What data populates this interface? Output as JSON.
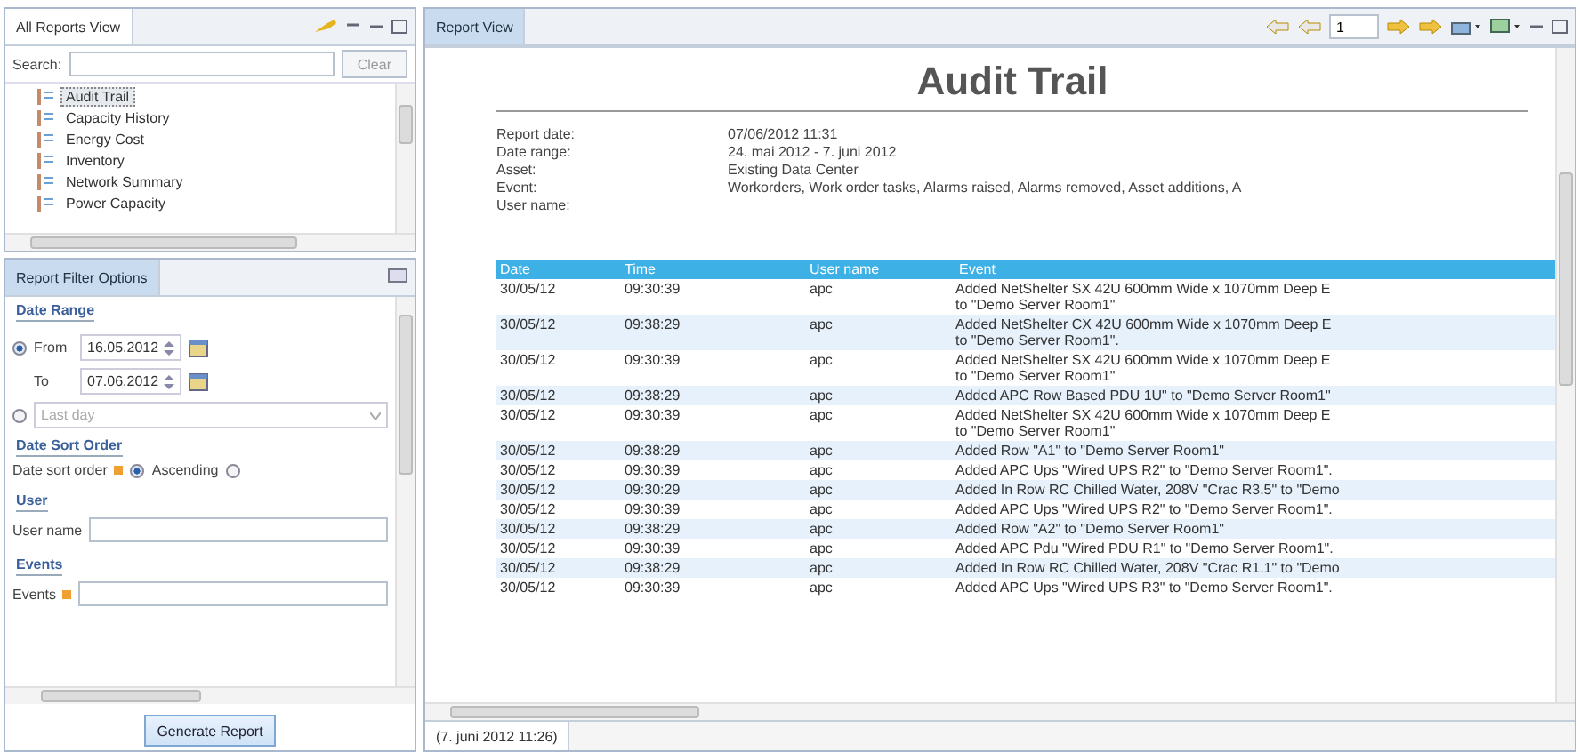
{
  "left_view": {
    "tab": "All Reports View",
    "search": {
      "label": "Search:"
    },
    "clear_button": "Clear",
    "reports": [
      {
        "label": "Audit Trail",
        "selected": true
      },
      {
        "label": "Capacity History",
        "selected": false
      },
      {
        "label": "Energy Cost",
        "selected": false
      },
      {
        "label": "Inventory",
        "selected": false
      },
      {
        "label": "Network Summary",
        "selected": false
      },
      {
        "label": "Power Capacity",
        "selected": false
      }
    ]
  },
  "filter": {
    "title": "Report Filter Options",
    "date_range": {
      "heading": "Date Range",
      "from_label": "From",
      "from": "16.05.2012",
      "to_label": "To",
      "to": "07.06.2012",
      "range_selected": true,
      "last_selected": false,
      "last_option": "Last day"
    },
    "sort": {
      "heading": "Date Sort Order",
      "label": "Date sort order",
      "option": "Ascending",
      "ascending": true,
      "other_selected": false
    },
    "user": {
      "heading": "User",
      "label": "User name"
    },
    "events": {
      "heading": "Events",
      "label": "Events"
    },
    "generate_button": "Generate Report"
  },
  "report_view": {
    "tab": "Report View",
    "page": "1",
    "title": "Audit Trail",
    "meta": [
      {
        "label": "Report date:",
        "value": "07/06/2012 11:31"
      },
      {
        "label": "Date range:",
        "value": "24. mai 2012 - 7. juni 2012"
      },
      {
        "label": "Asset:",
        "value": "Existing Data Center"
      },
      {
        "label": "Event:",
        "value": "Workorders, Work order tasks, Alarms raised, Alarms removed, Asset additions, A"
      },
      {
        "label": "User name:"
      }
    ],
    "columns": [
      "Date",
      "Time",
      "User name",
      "Event"
    ],
    "rows": [
      {
        "date": "30/05/12",
        "time": "09:30:39",
        "user": "apc",
        "event": [
          "Added NetShelter SX 42U 600mm Wide x 1070mm Deep E",
          "to \"Demo Server Room1\""
        ]
      },
      {
        "date": "30/05/12",
        "time": "09:38:29",
        "user": "apc",
        "event": [
          "Added NetShelter CX 42U 600mm Wide x 1070mm Deep E",
          "to \"Demo Server Room1\"."
        ]
      },
      {
        "date": "30/05/12",
        "time": "09:30:39",
        "user": "apc",
        "event": [
          "Added NetShelter SX 42U 600mm Wide x 1070mm Deep E",
          "to \"Demo Server Room1\""
        ]
      },
      {
        "date": "30/05/12",
        "time": "09:38:29",
        "user": "apc",
        "event": [
          "Added APC Row Based PDU 1U\" to \"Demo Server Room1\""
        ]
      },
      {
        "date": "30/05/12",
        "time": "09:30:39",
        "user": "apc",
        "event": [
          "Added NetShelter SX 42U 600mm Wide x 1070mm Deep E",
          "to \"Demo Server Room1\""
        ]
      },
      {
        "date": "30/05/12",
        "time": "09:38:29",
        "user": "apc",
        "event": [
          "Added Row \"A1\" to \"Demo Server Room1\""
        ]
      },
      {
        "date": "30/05/12",
        "time": "09:30:39",
        "user": "apc",
        "event": [
          "Added APC Ups \"Wired UPS R2\" to \"Demo Server Room1\"."
        ]
      },
      {
        "date": "30/05/12",
        "time": "09:30:29",
        "user": "apc",
        "event": [
          "Added In Row RC Chilled Water, 208V \"Crac R3.5\" to \"Demo"
        ]
      },
      {
        "date": "30/05/12",
        "time": "09:30:39",
        "user": "apc",
        "event": [
          "Added APC Ups \"Wired UPS R2\" to \"Demo Server Room1\"."
        ]
      },
      {
        "date": "30/05/12",
        "time": "09:38:29",
        "user": "apc",
        "event": [
          "Added Row \"A2\" to \"Demo Server Room1\""
        ]
      },
      {
        "date": "30/05/12",
        "time": "09:30:39",
        "user": "apc",
        "event": [
          "Added APC Pdu \"Wired PDU R1\" to \"Demo Server Room1\"."
        ]
      },
      {
        "date": "30/05/12",
        "time": "09:38:29",
        "user": "apc",
        "event": [
          "Added In Row RC Chilled Water, 208V \"Crac R1.1\" to \"Demo"
        ]
      },
      {
        "date": "30/05/12",
        "time": "09:30:39",
        "user": "apc",
        "event": [
          "Added APC Ups \"Wired UPS R3\" to \"Demo Server Room1\"."
        ]
      }
    ],
    "bottom_tab": "(7. juni 2012 11:26)"
  }
}
